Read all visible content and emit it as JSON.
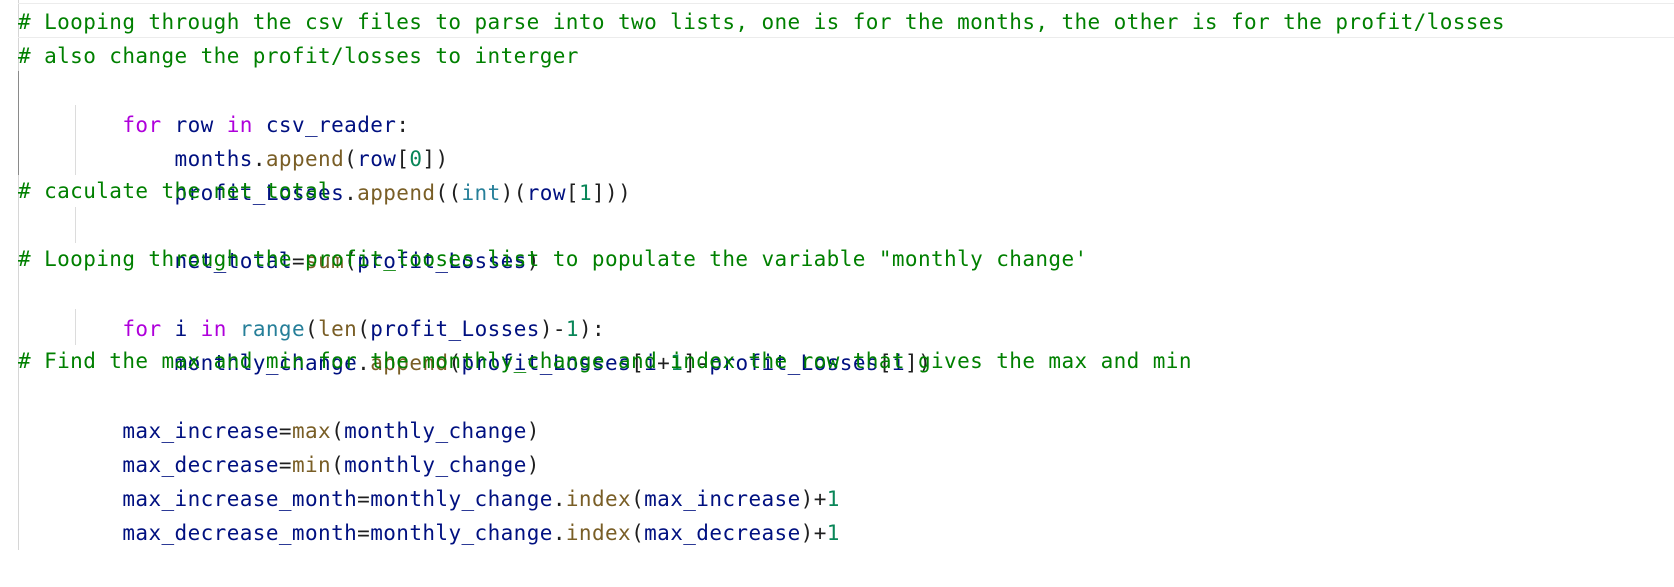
{
  "editor": {
    "language": "python",
    "colors": {
      "comment": "#008000",
      "keyword": "#af00db",
      "variable": "#001080",
      "function": "#795e26",
      "builtin_type": "#267f99",
      "number": "#098658",
      "punctuation": "#1f1f1f"
    },
    "lines": [
      "# Looping through the csv files to parse into two lists, one is for the months, the other is for the profit/losses",
      "# also change the profit/losses to interger",
      "    for row in csv_reader:",
      "        months.append(row[0])",
      "        profit_Losses.append((int)(row[1]))",
      "# caculate the net total",
      "        net_total=sum(profit_Losses)",
      "# Looping through the profit_looses list to populate the variable \"monthly change'",
      "    for i in range(len(profit_Losses)-1):",
      "        monthly_change.append(profit_Losses[i+1]-profit_Losses[i])",
      "# Find the max and min for the monthly_change and index the row that gives the max and min",
      "    max_increase=max(monthly_change)",
      "    max_decrease=min(monthly_change)",
      "    max_increase_month=monthly_change.index(max_increase)+1",
      "    max_decrease_month=monthly_change.index(max_decrease)+1"
    ]
  }
}
